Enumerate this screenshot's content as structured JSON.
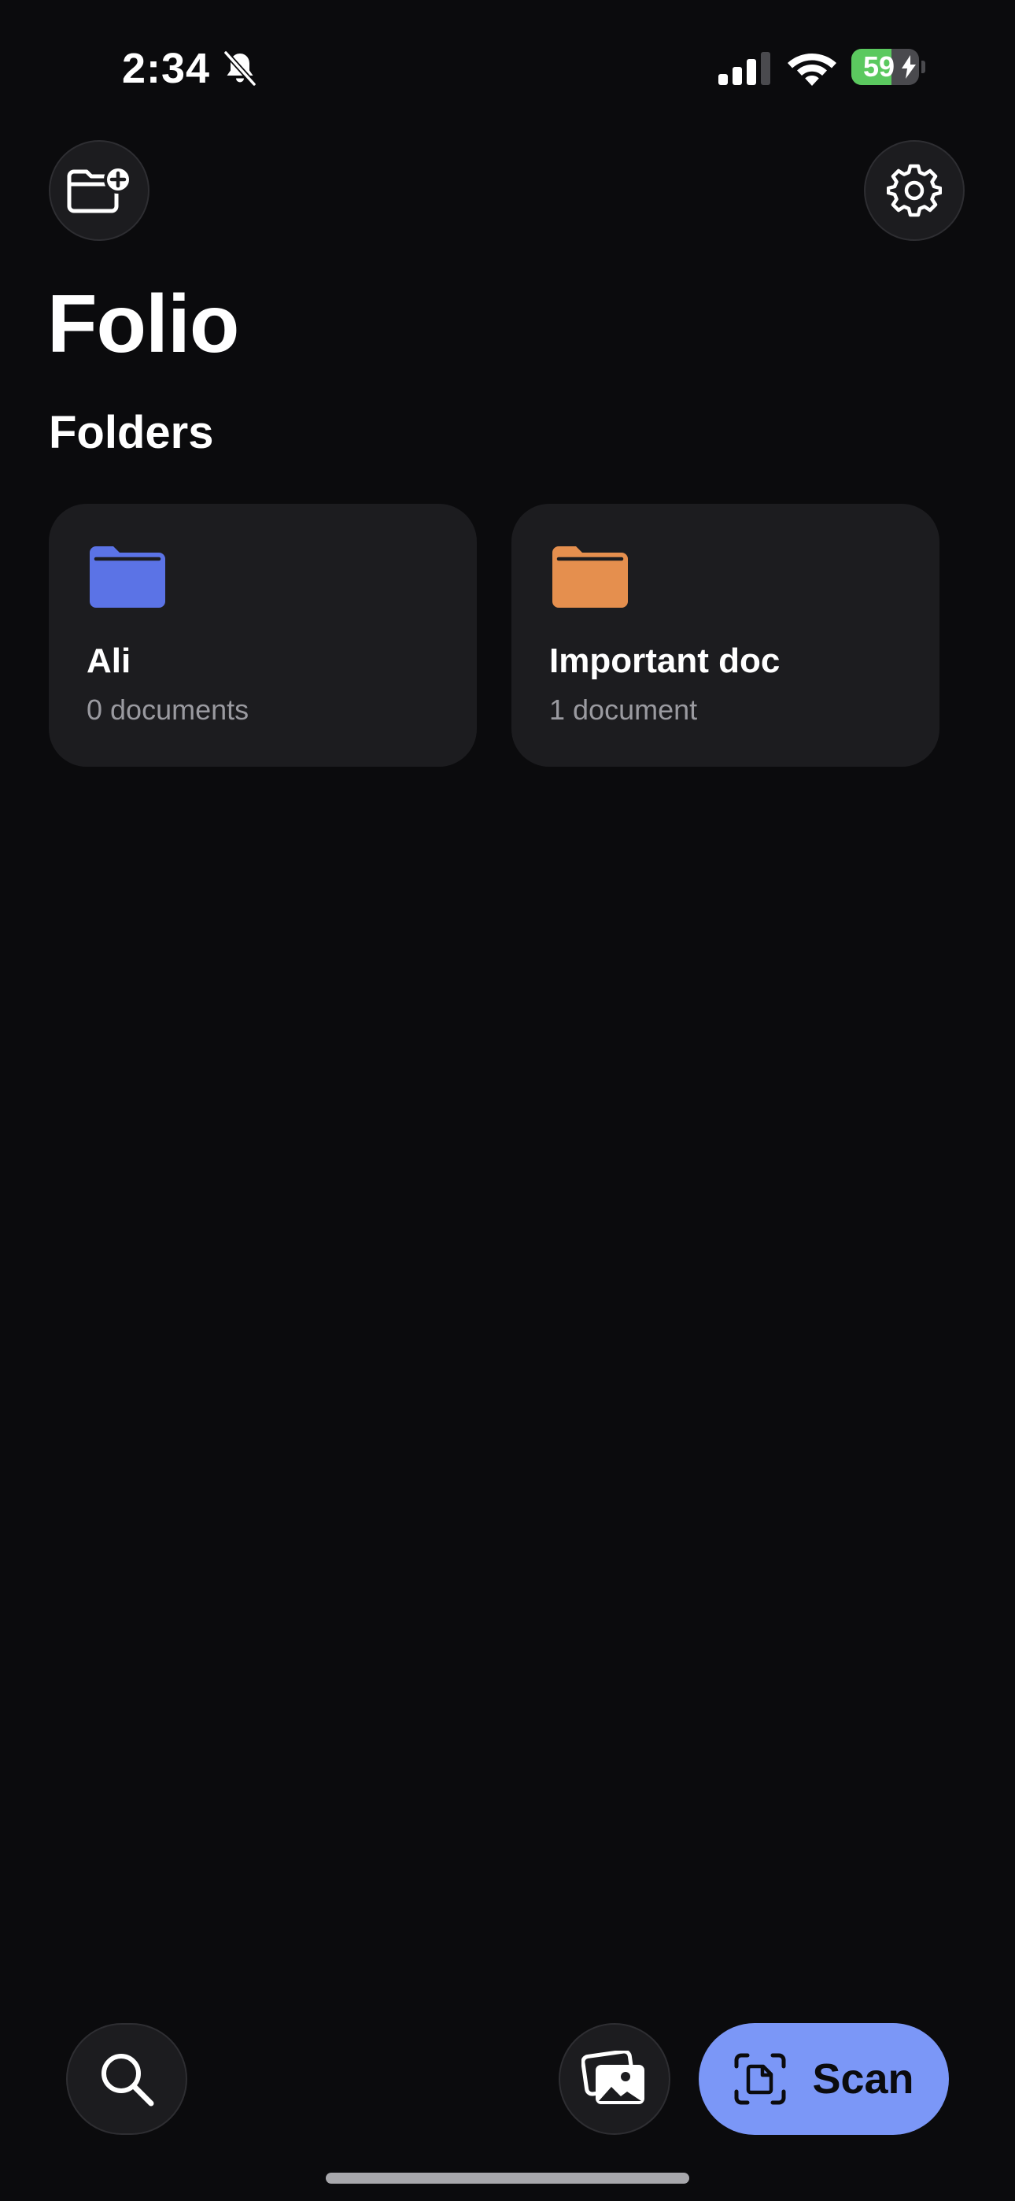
{
  "status_bar": {
    "time": "2:34",
    "battery_level": "59",
    "battery_fraction": 0.59,
    "battery_color": "#5bc95f",
    "icons": [
      "bell-slash-icon",
      "signal-icon",
      "wifi-icon",
      "battery-icon",
      "bolt-icon"
    ]
  },
  "header": {
    "new_folder_icon": "folder-plus-icon",
    "settings_icon": "gear-icon"
  },
  "app_title": "Folio",
  "section_title": "Folders",
  "folders": [
    {
      "name": "Ali",
      "count": "0 documents",
      "color": "#5b73e6"
    },
    {
      "name": "Important doc",
      "count": "1 document",
      "color": "#e58f4e"
    }
  ],
  "bottom_bar": {
    "search_icon": "search-icon",
    "photos_icon": "photos-icon",
    "scan_icon": "document-scan-icon",
    "scan_label": "Scan",
    "accent": "#7b97f7"
  }
}
